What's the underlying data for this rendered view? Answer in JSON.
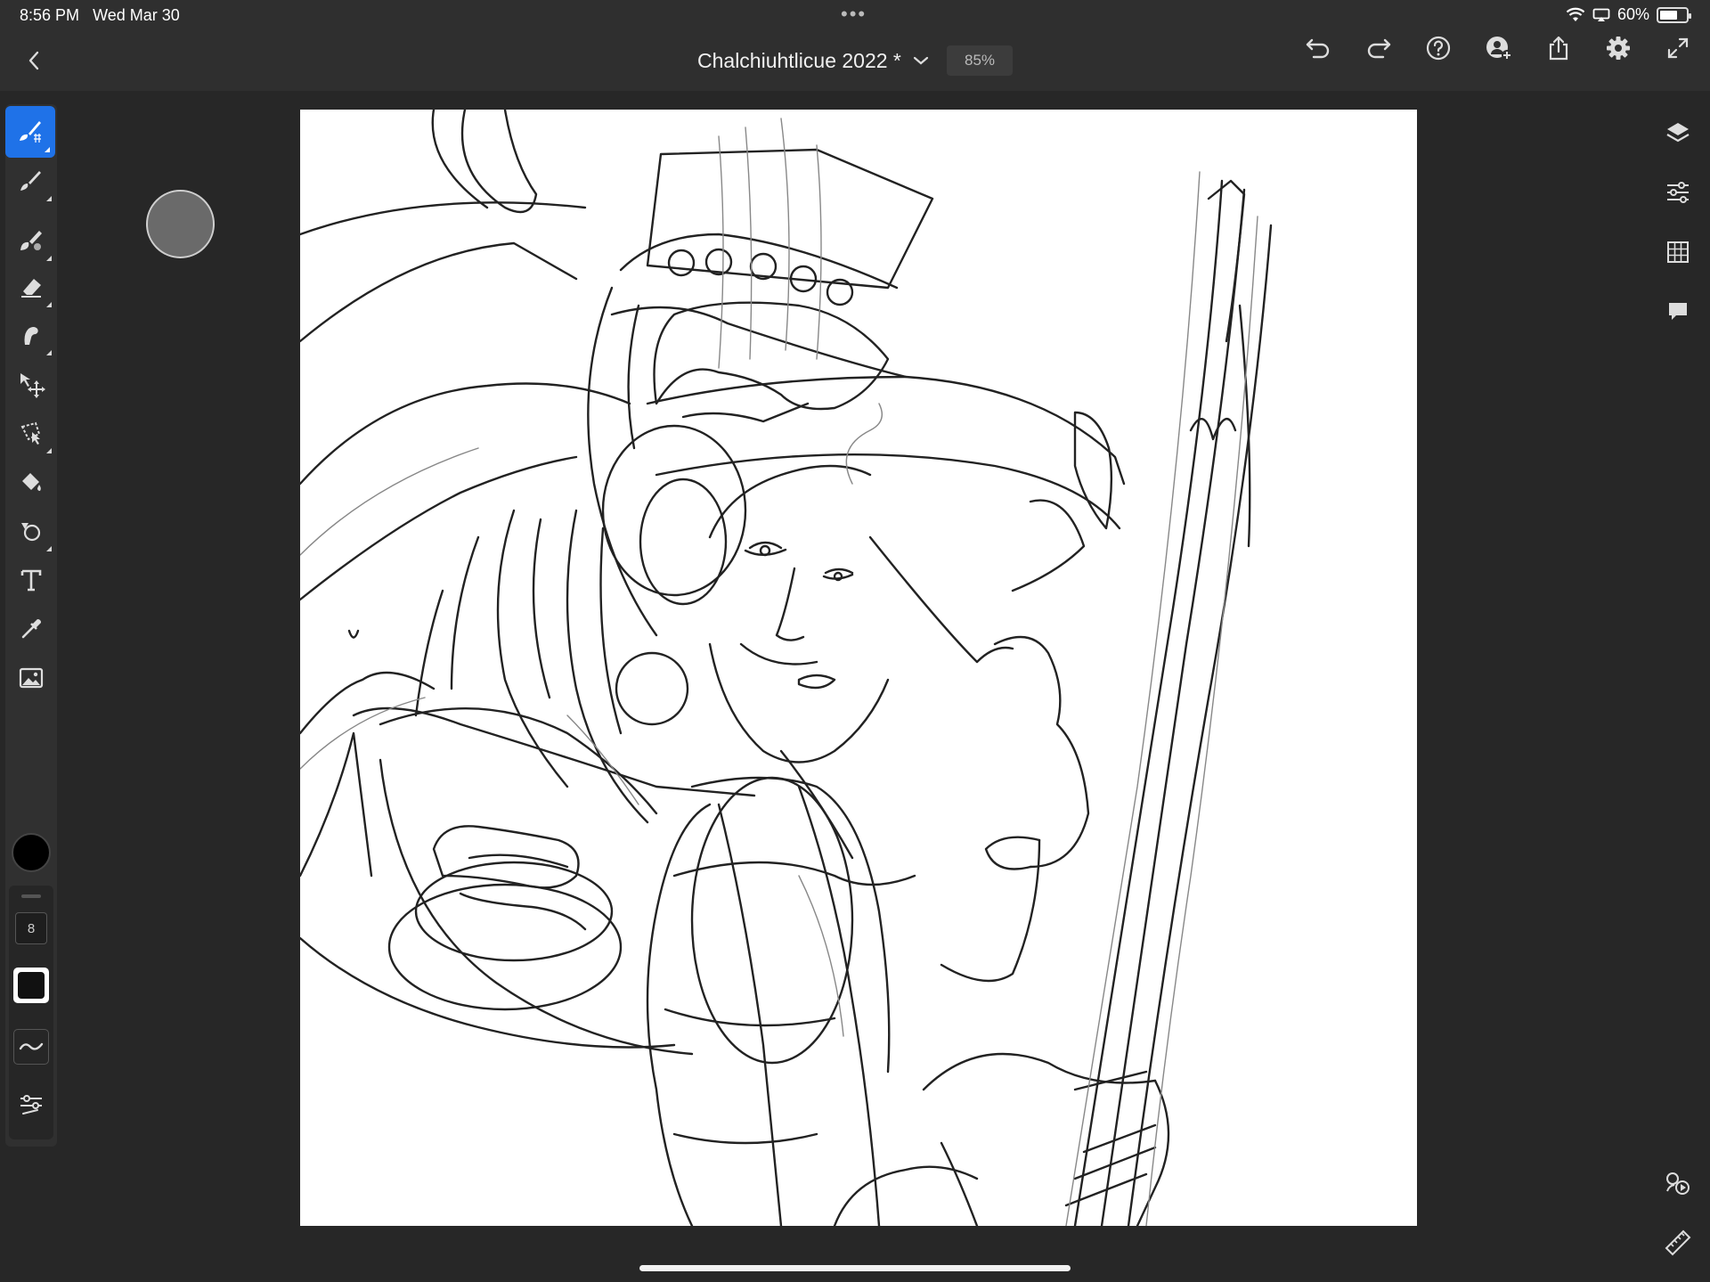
{
  "status_bar": {
    "time": "8:56 PM",
    "date": "Wed Mar 30",
    "battery": "60%"
  },
  "title_bar": {
    "document_title": "Chalchiuhtlicue 2022 *",
    "zoom": "85%"
  },
  "left_toolbar": {
    "tools": [
      {
        "name": "paint-brush-tool-icon",
        "active": true
      },
      {
        "name": "pixel-brush-icon",
        "active": false
      },
      {
        "name": "mixer-brush-icon",
        "active": false
      },
      {
        "name": "eraser-icon",
        "active": false
      },
      {
        "name": "smudge-icon",
        "active": false
      },
      {
        "name": "move-transform-icon",
        "active": false
      },
      {
        "name": "lasso-selection-icon",
        "active": false
      },
      {
        "name": "paint-bucket-icon",
        "active": false
      },
      {
        "name": "shape-tool-icon",
        "active": false
      },
      {
        "name": "text-tool-icon",
        "active": false
      },
      {
        "name": "eyedropper-icon",
        "active": false
      },
      {
        "name": "place-image-icon",
        "active": false
      }
    ],
    "color": "#000000",
    "brush_size": "8",
    "accent_color": "#1f72e8"
  },
  "right_toolbar": {
    "tools": [
      "layers-icon",
      "adjustments-icon",
      "grid-icon",
      "comments-icon"
    ],
    "bottom_tools": [
      "replay-icon",
      "ruler-icon"
    ]
  }
}
